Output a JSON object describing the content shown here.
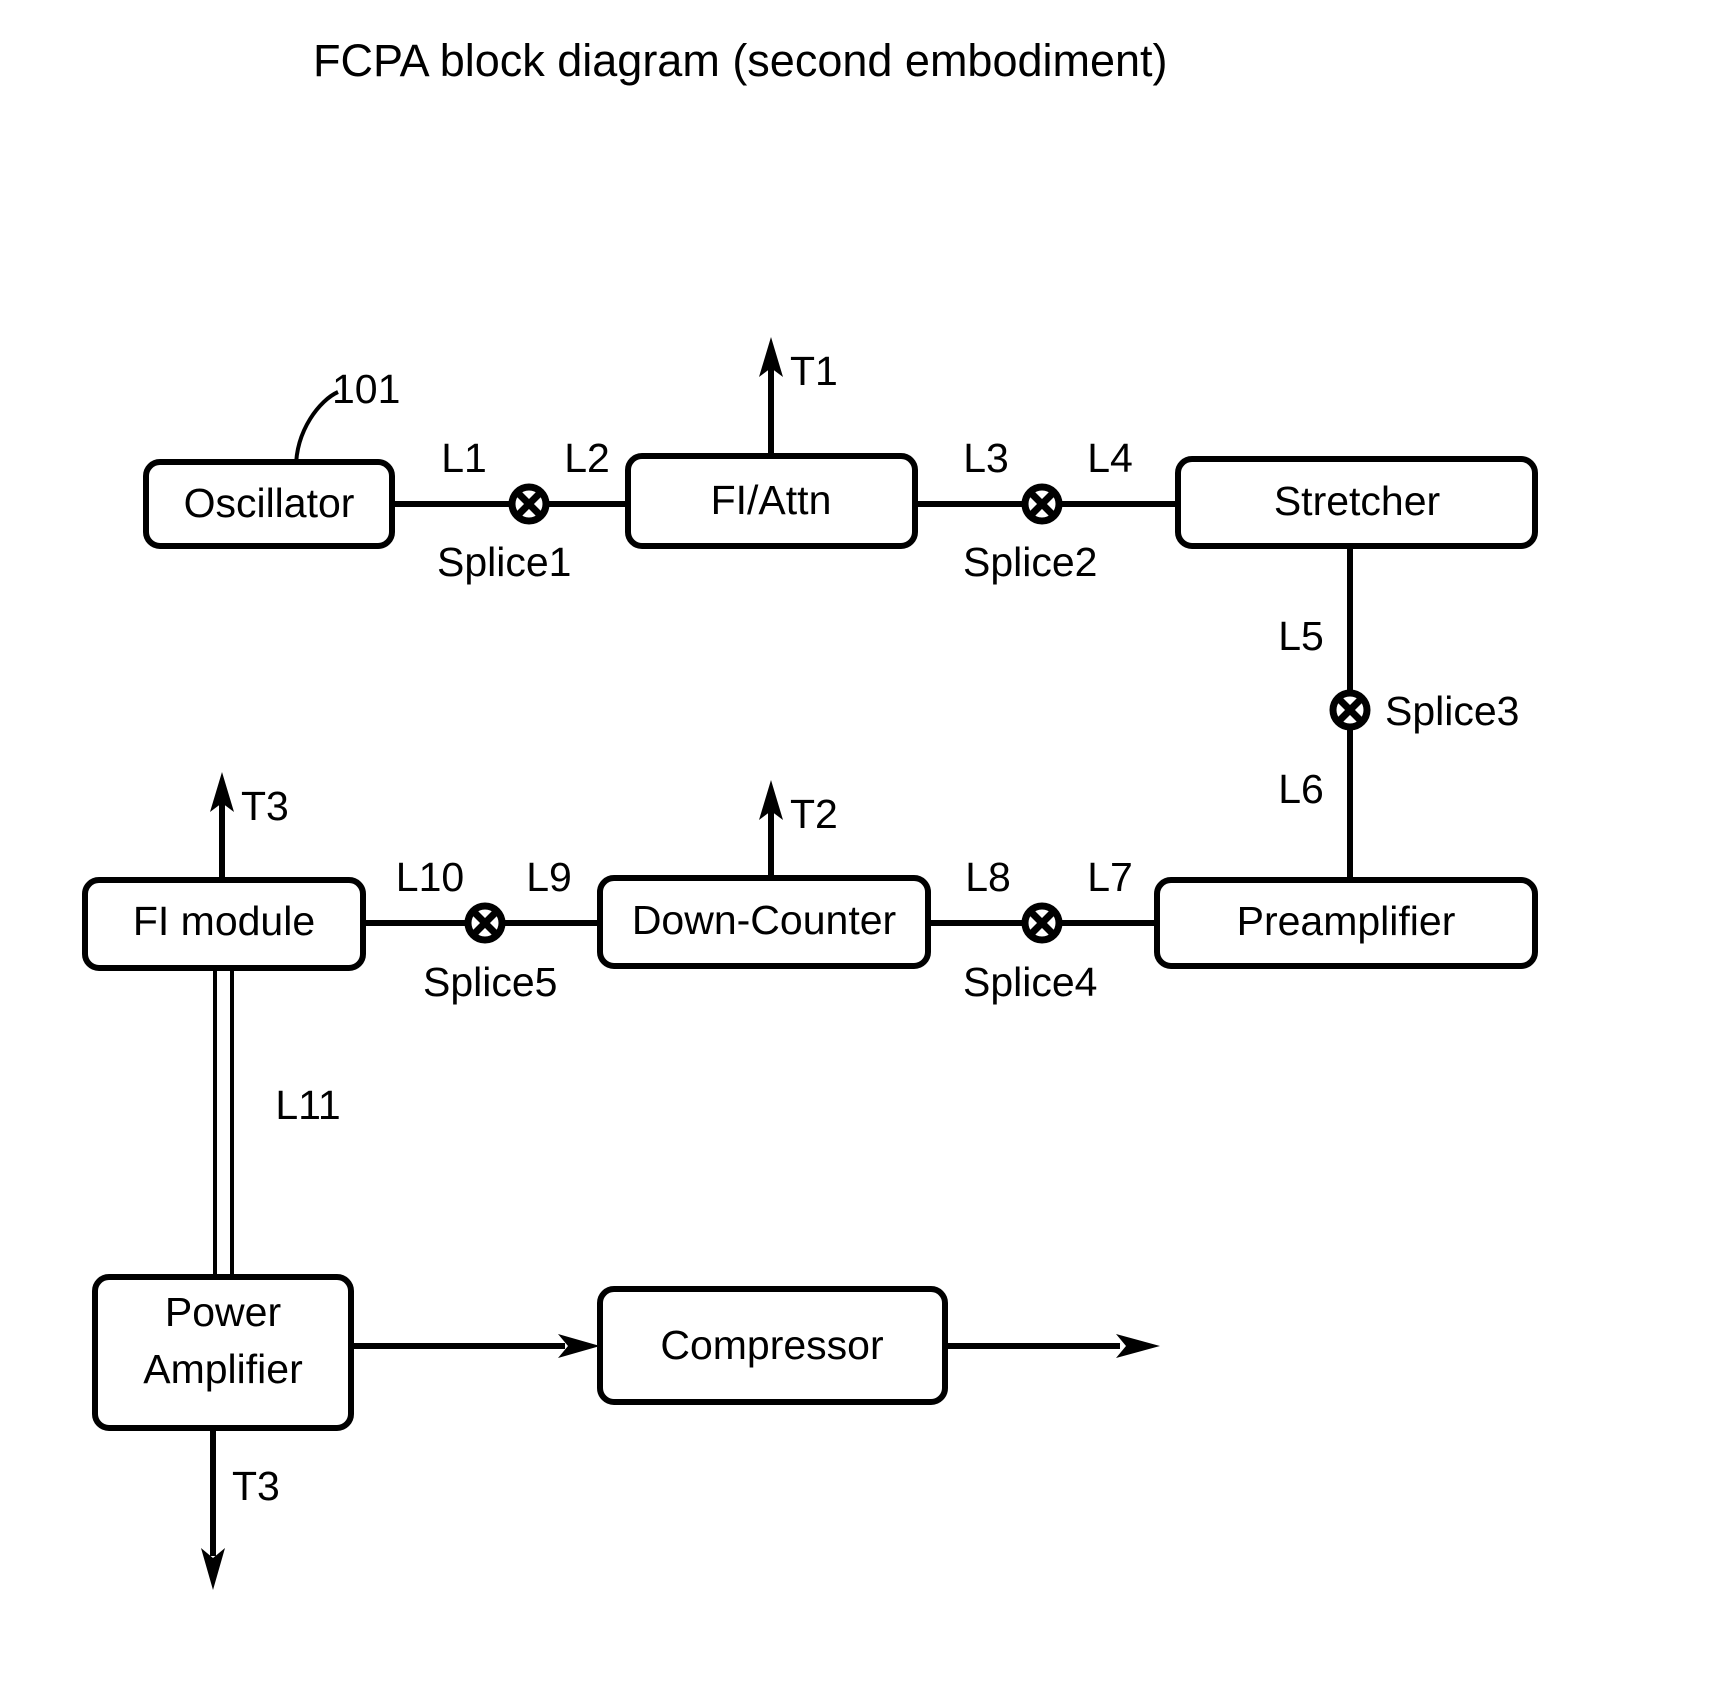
{
  "figure": {
    "title": "FCPA block diagram (second embodiment)",
    "reference_numeral": "101"
  },
  "blocks": [
    {
      "id": "oscillator",
      "label": "Oscillator"
    },
    {
      "id": "fi-attn",
      "label": "FI/Attn"
    },
    {
      "id": "stretcher",
      "label": "Stretcher"
    },
    {
      "id": "preamplifier",
      "label": "Preamplifier"
    },
    {
      "id": "down-counter",
      "label": "Down-Counter"
    },
    {
      "id": "fi-module",
      "label": "FI module"
    },
    {
      "id": "power-amp-1",
      "label": "Power"
    },
    {
      "id": "power-amp-2",
      "label": "Amplifier"
    },
    {
      "id": "compressor",
      "label": "Compressor"
    }
  ],
  "fiber_segments": [
    {
      "id": "L1",
      "label": "L1"
    },
    {
      "id": "L2",
      "label": "L2"
    },
    {
      "id": "L3",
      "label": "L3"
    },
    {
      "id": "L4",
      "label": "L4"
    },
    {
      "id": "L5",
      "label": "L5"
    },
    {
      "id": "L6",
      "label": "L6"
    },
    {
      "id": "L7",
      "label": "L7"
    },
    {
      "id": "L8",
      "label": "L8"
    },
    {
      "id": "L9",
      "label": "L9"
    },
    {
      "id": "L10",
      "label": "L10"
    },
    {
      "id": "L11",
      "label": "L11"
    }
  ],
  "splices": [
    {
      "id": "splice1",
      "label": "Splice1"
    },
    {
      "id": "splice2",
      "label": "Splice2"
    },
    {
      "id": "splice3",
      "label": "Splice3"
    },
    {
      "id": "splice4",
      "label": "Splice4"
    },
    {
      "id": "splice5",
      "label": "Splice5"
    }
  ],
  "taps": [
    {
      "id": "t1",
      "label": "T1"
    },
    {
      "id": "t2",
      "label": "T2"
    },
    {
      "id": "t3-upper",
      "label": "T3"
    },
    {
      "id": "t3-lower",
      "label": "T3"
    }
  ],
  "colors": {
    "line": "#000000",
    "background": "#ffffff",
    "text": "#000000"
  }
}
